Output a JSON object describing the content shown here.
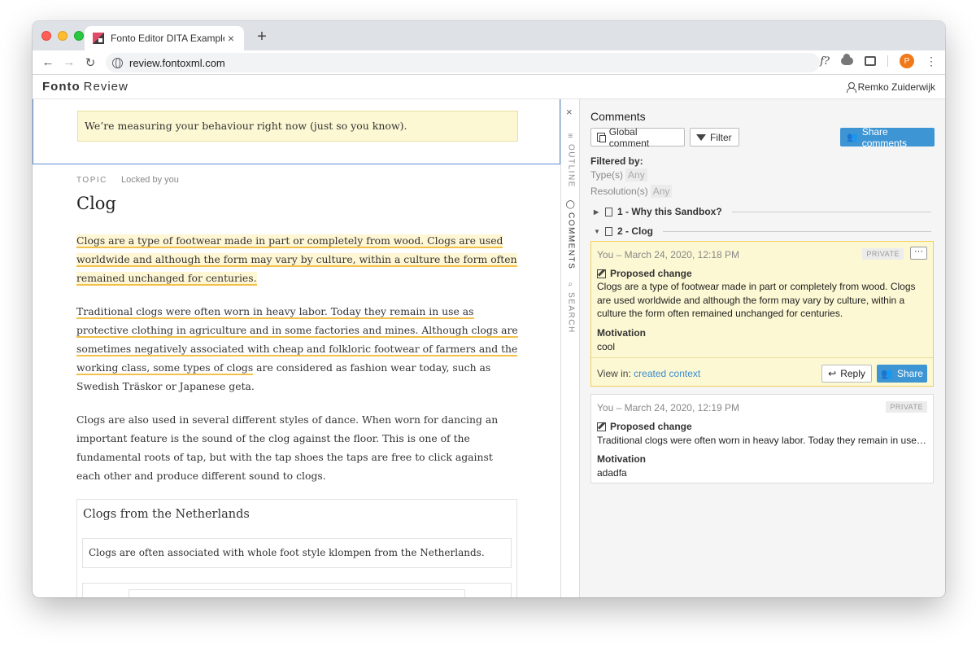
{
  "browser": {
    "tab_title": "Fonto Editor DITA Example",
    "tab_close": "×",
    "new_tab": "+",
    "url": "review.fontoxml.com",
    "back": "←",
    "forward": "→",
    "reload": "↻",
    "ext_fx": "f?",
    "profile_initial": "P",
    "menu": "⋮"
  },
  "app": {
    "brand_bold": "Fonto",
    "brand_light": "Review",
    "user_name": "Remko Zuiderwijk"
  },
  "editor": {
    "notice": "We’re measuring your behaviour right now (just so you know).",
    "topic_label": "TOPIC",
    "lock_status": "Locked by you",
    "title": "Clog",
    "p1": "Clogs are a type of footwear made in part or completely from wood. Clogs are used worldwide and although the form may vary by culture, within a culture the form often remained unchanged for centuries.",
    "p2_highlighted": "Traditional clogs were often worn in heavy labor. Today they remain in use as protective clothing in agriculture and in some factories and mines. Although clogs are sometimes negatively associated with cheap and folkloric footwear of farmers and the working class, some types of clogs",
    "p2_rest": " are considered as fashion wear today, such as Swedish Träskor or Japanese geta.",
    "p3": "Clogs are also used in several different styles of dance. When worn for dancing an important feature is the sound of the clog against the floor. This is one of the fundamental roots of tap, but with the tap shoes the taps are free to click against each other and produce different sound to clogs.",
    "section_title": "Clogs from the Netherlands",
    "section_text": "Clogs are often associated with whole foot style klompen from the Netherlands."
  },
  "rail": {
    "close": "×",
    "outline": "OUTLINE",
    "comments": "COMMENTS",
    "search": "SEARCH"
  },
  "comments": {
    "title": "Comments",
    "global_btn": "Global comment",
    "filter_btn": "Filter",
    "share_btn": "Share comments",
    "filtered_by": "Filtered by:",
    "types_label": "Type(s)",
    "types_value": "Any",
    "resolution_label": "Resolution(s)",
    "resolution_value": "Any",
    "tree": [
      {
        "label": "1 - Why this Sandbox?",
        "expanded": false
      },
      {
        "label": "2 - Clog",
        "expanded": true
      }
    ],
    "cards": [
      {
        "meta": "You – March 24, 2020, 12:18 PM",
        "badge": "PRIVATE",
        "more": "···",
        "type": "Proposed change",
        "text": "Clogs are a type of footwear made in part or completely from wood. Clogs are used worldwide and although the form may vary by culture, within a culture the form often remained unchanged for centuries.",
        "motivation_label": "Motivation",
        "motivation": "cool",
        "view_in": "View in:",
        "view_link": "created context",
        "reply": "Reply",
        "share": "Share"
      },
      {
        "meta": "You – March 24, 2020, 12:19 PM",
        "badge": "PRIVATE",
        "type": "Proposed change",
        "text": "Traditional clogs were often worn in heavy labor. Today they remain in use as protective clothing in agriculture and in some factories and mines.",
        "motivation_label": "Motivation",
        "motivation": "adadfa"
      }
    ]
  },
  "colors": {
    "accent": "#3d95d4",
    "highlight": "#fcf8d3",
    "underline": "#f2c14a"
  }
}
